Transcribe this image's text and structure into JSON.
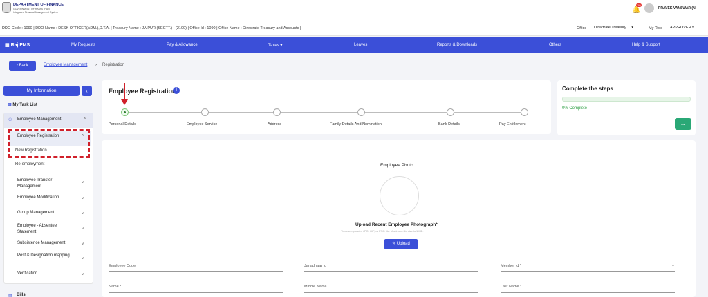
{
  "header": {
    "dept": "DEPARTMENT OF FINANCE",
    "gov": "GOVERNMENT OF RAJASTHAN",
    "system": "Integrated Financial Management System",
    "notif_count": "10",
    "user": "PRAVEK VANSWAR (N"
  },
  "infobar": {
    "text": "DDO Code : 1090  |  DDO Name : DESK OFFICER(ADM.),D.T.A.  |  Treasury Name : JAIPUR (SECTT.) - (2100)  |  Office Id : 1090  |  Office Name : Directrate Treasury and Accounts  |",
    "office_label": "Office",
    "office_value": "Directrate Treasury ...",
    "role_label": "My Role",
    "role_value": "APPROVER"
  },
  "nav": {
    "brand": "RajIFMS",
    "items": [
      "My Requests",
      "Pay & Allowance",
      "Taxes",
      "Leaves",
      "Reports & Downloads",
      "Others",
      "Help & Support"
    ]
  },
  "breadcrumb": {
    "back": "Back",
    "parent": "Employee Management",
    "current": "Registration"
  },
  "sidebar": {
    "my_information": "My Information",
    "task_list": "My Task List",
    "section": "Employee Management",
    "items": [
      "Employee Registration",
      "New Registration",
      "Re-employment",
      "Employee Transfer Management",
      "Employee Modification",
      "Group Management",
      "Employee - Absentee Statement",
      "Subsistence Management",
      "Post & Designation mapping",
      "Verification"
    ],
    "bills": "Bills"
  },
  "registration": {
    "title": "Employee Registration",
    "steps": [
      "Personal Details",
      "Employee Service",
      "Address",
      "Family Details And Nomination",
      "Bank Details",
      "Pay Entitlement"
    ]
  },
  "complete": {
    "title": "Complete the steps",
    "percent": "0% Complete",
    "progress": 0
  },
  "photo": {
    "title": "Employee Photo",
    "upload_title": "Upload Recent Employee Photograph*",
    "hint": "You can upload a JPG, GIF, or PNG file. Maximum file size is 1 MB.",
    "upload_button": "Upload"
  },
  "form": {
    "fields": [
      "Employee Code",
      "Janadhaar Id",
      "Member Id *",
      "Name *",
      "Middle Name",
      "Last Name *"
    ]
  }
}
